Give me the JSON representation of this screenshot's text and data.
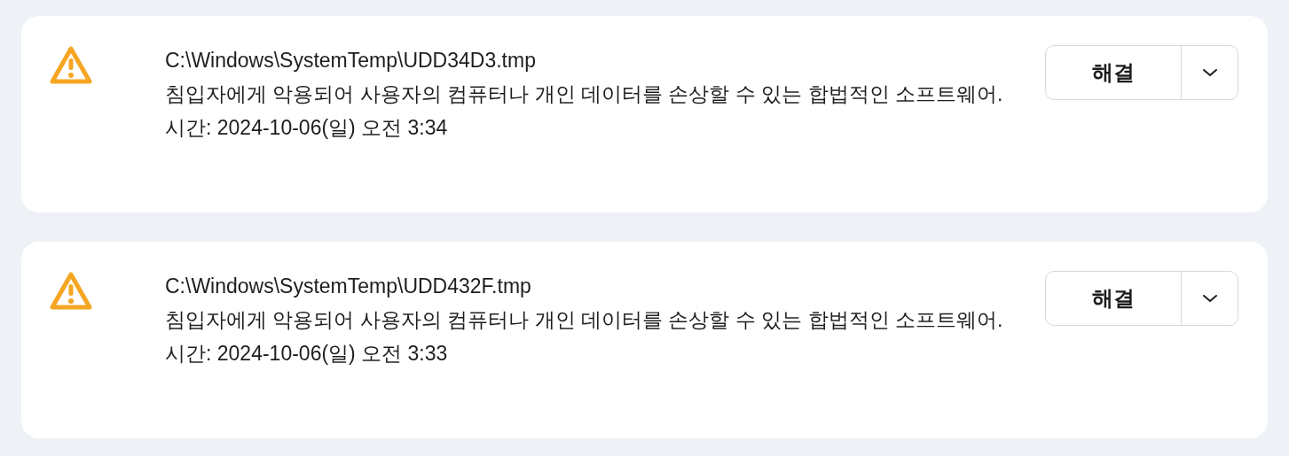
{
  "alerts": [
    {
      "path": "C:\\Windows\\SystemTemp\\UDD34D3.tmp",
      "description": "침입자에게 악용되어 사용자의 컴퓨터나 개인 데이터를 손상할 수 있는 합법적인 소프트웨어.",
      "time": "시간: 2024-10-06(일) 오전 3:34",
      "action": "해결"
    },
    {
      "path": "C:\\Windows\\SystemTemp\\UDD432F.tmp",
      "description": "침입자에게 악용되어 사용자의 컴퓨터나 개인 데이터를 손상할 수 있는 합법적인 소프트웨어.",
      "time": "시간: 2024-10-06(일) 오전 3:33",
      "action": "해결"
    }
  ]
}
